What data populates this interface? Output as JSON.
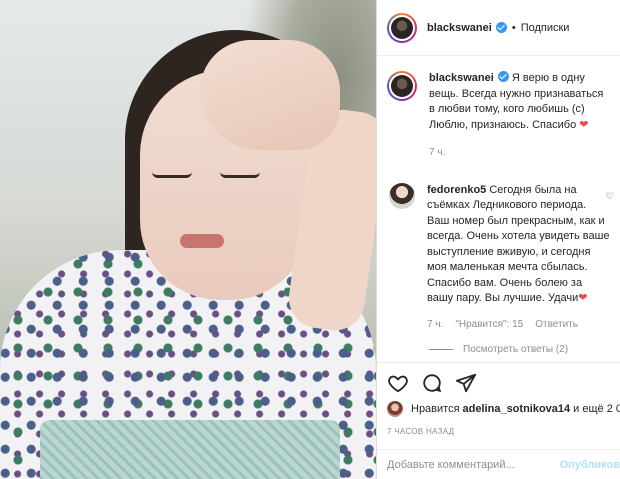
{
  "post": {
    "author": "blackswanei",
    "follow_label": "Подписки",
    "dot": "•",
    "caption": {
      "username": "blackswanei",
      "text": "Я верю в одну вещь. Всегда нужно признаваться в любви тому, кого любишь (с) Люблю, признаюсь. Спасибо",
      "heart": "❤",
      "time": "7 ч."
    },
    "comment": {
      "username": "fedorenko5",
      "text": "Сегодня была на съёмках Ледникового периода. Ваш номер был прекрасным, как и всегда. Очень хотела увидеть ваше выступление вживую, и сегодня моя маленькая мечта сбылась. Спасибо вам. Очень болею за вашу пару. Вы лучшие. Удачи",
      "heart": "❤",
      "time": "7 ч.",
      "likes": "\"Нравится\": 15",
      "reply": "Ответить",
      "view_replies": "Посмотреть ответы (2)",
      "like_icon": "♡"
    },
    "likes": {
      "prefix": "Нравится",
      "user": "adelina_sotnikova14",
      "suffix": "и ещё 2 0"
    },
    "ago": "7 ЧАСОВ НАЗАД",
    "add_comment_placeholder": "Добавьте комментарий...",
    "publish_label": "Опубликова"
  },
  "icons": {
    "like": "heart-icon",
    "comment": "comment-icon",
    "share": "share-icon",
    "verified": "verified-badge-icon"
  },
  "colors": {
    "verified": "#3897f0",
    "heart": "#ed4956",
    "publish_disabled": "#b2dffc",
    "muted": "#8e8e8e"
  }
}
